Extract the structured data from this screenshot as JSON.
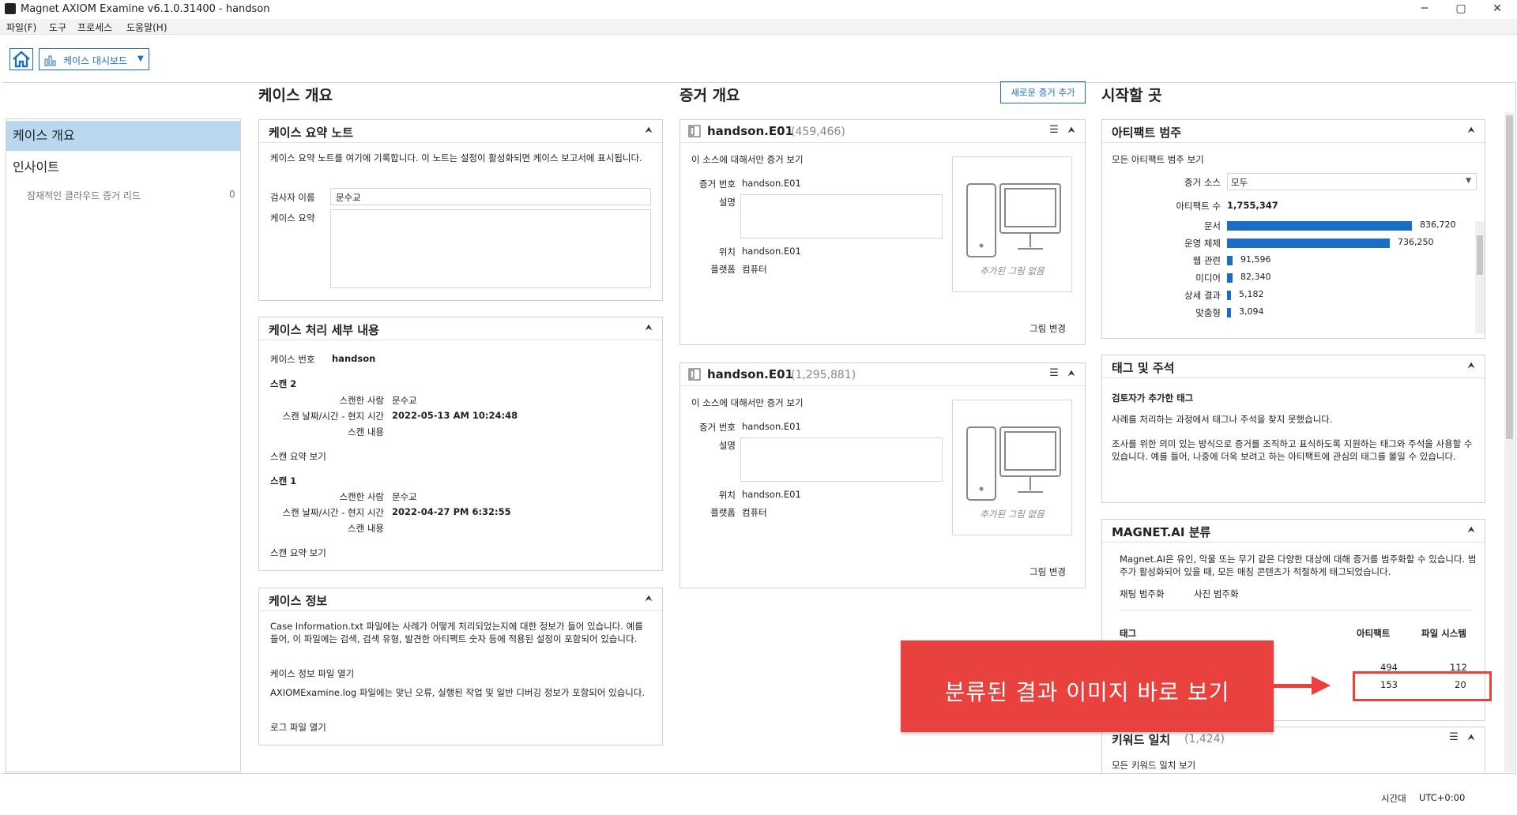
{
  "window": {
    "title": "Magnet AXIOM Examine v6.1.0.31400 - handson"
  },
  "menu": [
    "파일(F)",
    "도구",
    "프로세스",
    "도움말(H)"
  ],
  "toolbar": {
    "dashboard_label": "케이스 대시보드"
  },
  "sidebar": {
    "items": [
      {
        "label": "케이스 개요",
        "active": true
      },
      {
        "label": "인사이트",
        "active": false
      }
    ],
    "sub": {
      "label": "잠재적인 클라우드 증거 리드",
      "count": "0"
    }
  },
  "case_overview": {
    "title": "케이스 개요",
    "summary_note": {
      "title": "케이스 요약 노트",
      "desc": "케이스 요약 노트를 여기에 기록합니다. 이 노트는 설정이 활성화되면 케이스 보고서에 표시됩니다.",
      "examiner_label": "검사자 이름",
      "examiner_value": "문수교",
      "summary_label": "케이스 요약"
    },
    "processing": {
      "title": "케이스 처리 세부 내용",
      "case_no_label": "케이스 번호",
      "case_no_value": "handson",
      "scans": [
        {
          "title": "스캔 2",
          "by_label": "스캔한 사람",
          "by": "문수교",
          "dt_label": "스캔 날짜/시간 - 현지 시간",
          "dt": "2022-05-13 AM 10:24:48",
          "content_label": "스캔 내용",
          "link": "스캔 요약 보기"
        },
        {
          "title": "스캔 1",
          "by_label": "스캔한 사람",
          "by": "문수교",
          "dt_label": "스캔 날짜/시간 - 현지 시간",
          "dt": "2022-04-27 PM 6:32:55",
          "content_label": "스캔 내용",
          "link": "스캔 요약 보기"
        }
      ]
    },
    "case_info": {
      "title": "케이스 정보",
      "desc1": "Case Information.txt 파일에는 사례가 어떻게 처리되었는지에 대한 정보가 들어 있습니다. 예를 들어, 이 파일에는 검색, 검색 유형, 발견한 아티팩트 숫자 등에 적용된 설정이 포함되어 있습니다.",
      "link1": "케이스 정보 파일 열기",
      "desc2": "AXIOMExamine.log 파일에는 맞닌 오류, 실행된 작업 및 일반 디버깅 정보가 포함되어 있습니다.",
      "link2": "로그 파일 열기"
    }
  },
  "evidence_overview": {
    "title": "증거 개요",
    "add_button": "새로운 증거 추가",
    "items": [
      {
        "name": "handson.E01",
        "count": "(459,466)",
        "link": "이 소스에 대해서만 증거 보기",
        "no_label": "증거 번호",
        "no": "handson.E01",
        "desc_label": "설명",
        "loc_label": "위치",
        "loc": "handson.E01",
        "plat_label": "플랫폼",
        "plat": "컴퓨터",
        "no_image": "추가된 그림 없음",
        "change_image": "그림 변경"
      },
      {
        "name": "handson.E01",
        "count": "(1,295,881)",
        "link": "이 소스에 대해서만 증거 보기",
        "no_label": "증거 번호",
        "no": "handson.E01",
        "desc_label": "설명",
        "loc_label": "위치",
        "loc": "handson.E01",
        "plat_label": "플랫폼",
        "plat": "컴퓨터",
        "no_image": "추가된 그림 없음",
        "change_image": "그림 변경"
      }
    ]
  },
  "start": {
    "title": "시작할 곳",
    "artifacts": {
      "title": "아티팩트 범주",
      "link": "모든 아티팩트 범주 보기",
      "source_label": "증거 소스",
      "source_value": "모두",
      "count_label": "아티팩트 수",
      "count_value": "1,755,347",
      "categories": [
        {
          "label": "문서",
          "value": "836,720",
          "frac": 1.0
        },
        {
          "label": "운영 체제",
          "value": "736,250",
          "frac": 0.88
        },
        {
          "label": "웹 관련",
          "value": "91,596",
          "frac": 0.03
        },
        {
          "label": "미디어",
          "value": "82,340",
          "frac": 0.03
        },
        {
          "label": "상세 결과",
          "value": "5,182",
          "frac": 0.02
        },
        {
          "label": "맞춤형",
          "value": "3,094",
          "frac": 0.02
        }
      ]
    },
    "tags": {
      "title": "태그 및 주석",
      "subtitle": "검토자가 추가한 태그",
      "desc1": "사례를 처리하는 과정에서 태그나 주석을 찾지 못했습니다.",
      "desc2": "조사를 위한 의미 있는 방식으로 증거를 조직하고 표식하도록 지원하는 태그와 주석을 사용할 수 있습니다. 예를 들어, 나중에 더욱 보려고 하는 아티팩트에 관심의 태그를 볼일 수 있습니다."
    },
    "magnet_ai": {
      "title": "MAGNET.AI 분류",
      "desc": "Magnet.AI은 유인, 악물 또는 무기 같은 다양한 대상에 대해 증거를 범주화할 수 있습니다. 범주가 활성화되어 있을 때, 모든 매칭 콘텐츠가 적절하게 태그되었습니다.",
      "link_chat": "채팅 범주화",
      "link_photo": "사진 범주화",
      "col_tag": "태그",
      "col_artifact": "아티팩트",
      "col_fs": "파일 시스템",
      "rows": [
        {
          "artifact": "494",
          "fs": "112"
        },
        {
          "artifact": "153",
          "fs": "20"
        }
      ]
    },
    "keywords": {
      "title": "키워드 일치",
      "count": "(1,424)",
      "link": "모든 키워드 일치 보기"
    }
  },
  "callout": {
    "text": "분류된 결과 이미지 바로 보기"
  },
  "status": {
    "tz_label": "시간대",
    "tz_value": "UTC+0:00"
  },
  "colors": {
    "accent": "#1a6fc4",
    "callout": "#e8413e",
    "sidebar_active": "#b9d8ef"
  }
}
